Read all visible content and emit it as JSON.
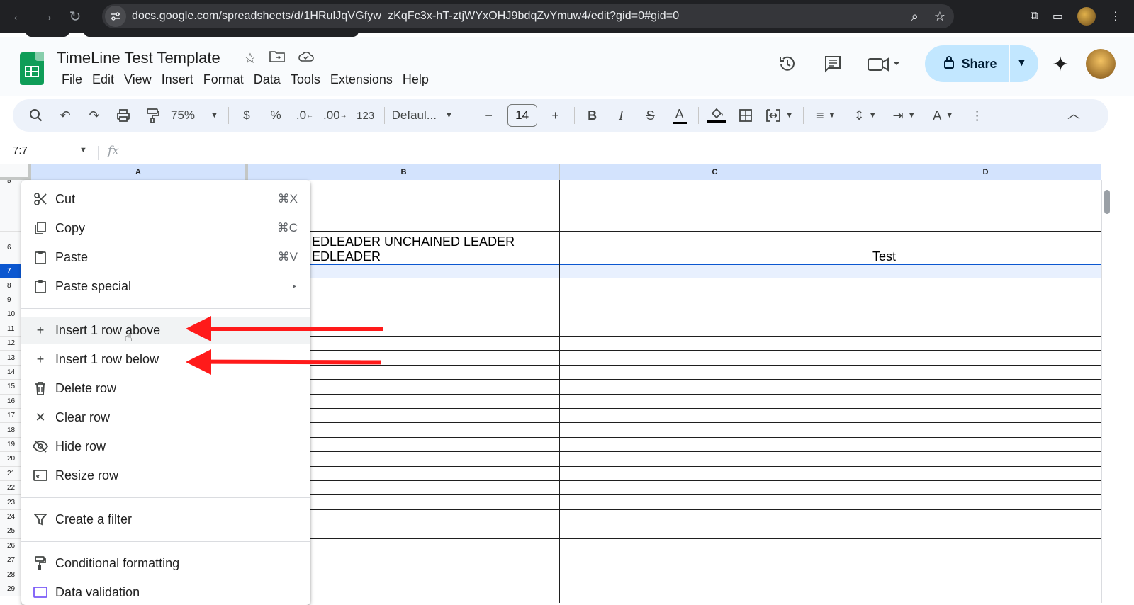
{
  "browser": {
    "url": "docs.google.com/spreadsheets/d/1HRulJqVGfyw_zKqFc3x-hT-ztjWYxOHJ9bdqZvYmuw4/edit?gid=0#gid=0"
  },
  "app": {
    "doc_title": "TimeLine Test Template",
    "menu": [
      "File",
      "Edit",
      "View",
      "Insert",
      "Format",
      "Data",
      "Tools",
      "Extensions",
      "Help"
    ],
    "share_label": "Share"
  },
  "toolbar": {
    "zoom": "75%",
    "currency": "$",
    "percent": "%",
    "dec_decrease": ".0",
    "dec_increase": ".00",
    "number_format": "123",
    "font": "Defaul...",
    "font_size": "14"
  },
  "formula_bar": {
    "name_box": "7:7",
    "fx": "fx"
  },
  "grid": {
    "columns": [
      "A",
      "B",
      "C",
      "D"
    ],
    "rows": [
      "5",
      "6",
      "7",
      "8",
      "9",
      "10",
      "11",
      "12",
      "13",
      "14",
      "15",
      "16",
      "17",
      "18",
      "19",
      "20",
      "21",
      "22",
      "23",
      "24",
      "25",
      "26",
      "27",
      "28",
      "29"
    ],
    "selected_row": "7",
    "cells": {
      "b6_line1": "EDLEADER   UNCHAINED LEADER",
      "b6_line2": "EDLEADER",
      "d6": "Test"
    }
  },
  "context_menu": {
    "items": [
      {
        "label": "Cut",
        "shortcut": "⌘X",
        "icon": "scissors-icon"
      },
      {
        "label": "Copy",
        "shortcut": "⌘C",
        "icon": "copy-icon"
      },
      {
        "label": "Paste",
        "shortcut": "⌘V",
        "icon": "clipboard-icon"
      },
      {
        "label": "Paste special",
        "shortcut": "▸",
        "icon": "clipboard-icon"
      },
      {
        "label": "Insert 1 row above",
        "icon": "plus-icon"
      },
      {
        "label": "Insert 1 row below",
        "icon": "plus-icon"
      },
      {
        "label": "Delete row",
        "icon": "trash-icon"
      },
      {
        "label": "Clear row",
        "icon": "close-icon"
      },
      {
        "label": "Hide row",
        "icon": "eye-off-icon"
      },
      {
        "label": "Resize row",
        "icon": "resize-icon"
      },
      {
        "label": "Create a filter",
        "icon": "filter-icon"
      },
      {
        "label": "Conditional formatting",
        "icon": "paint-roller-icon"
      },
      {
        "label": "Data validation",
        "icon": "data-validation-icon"
      }
    ]
  },
  "colors": {
    "accent": "#0b57d0",
    "share_bg": "#c2e7ff",
    "annotation": "#ff1a1a",
    "selection_fill": "#e8f0fe"
  }
}
